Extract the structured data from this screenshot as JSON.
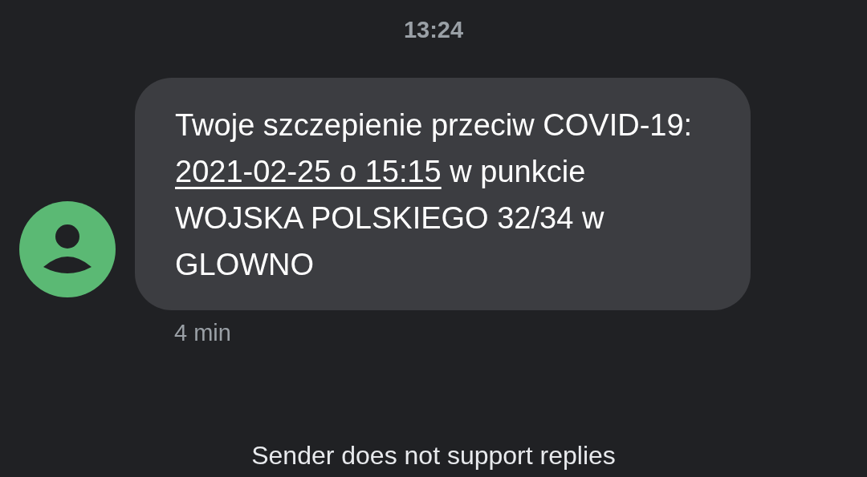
{
  "time_header": "13:24",
  "message": {
    "text_before": "Twoje szczepienie przeciw COVID-19: ",
    "link": "2021-02-25 o 15:15",
    "text_after": " w punkcie WOJSKA POLSKIEGO 32/34 w GLOWNO",
    "timestamp": "4 min"
  },
  "footer": "Sender does not support replies"
}
